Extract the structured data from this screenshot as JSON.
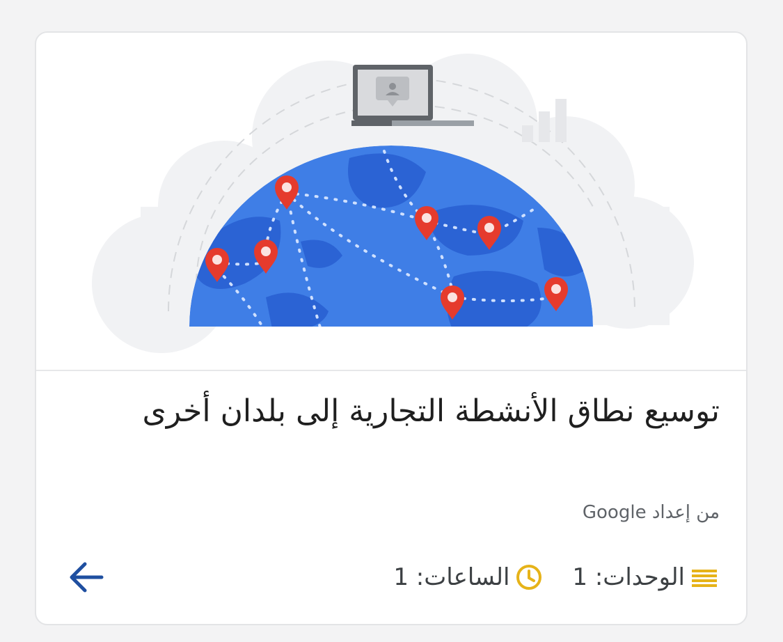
{
  "course": {
    "title": "توسيع نطاق الأنشطة التجارية إلى بلدان أخرى",
    "byline": "من إعداد Google",
    "units_label": "الوحدات: 1",
    "hours_label": "الساعات: 1"
  },
  "icons": {
    "units": "list-lines-icon",
    "hours": "clock-icon",
    "back": "arrow-left-icon"
  },
  "colors": {
    "globe": "#3d7be0",
    "land": "#2a5fcf",
    "pin": "#e23b2e",
    "accent_yellow": "#e6b319",
    "arrow": "#1f4fa0"
  }
}
